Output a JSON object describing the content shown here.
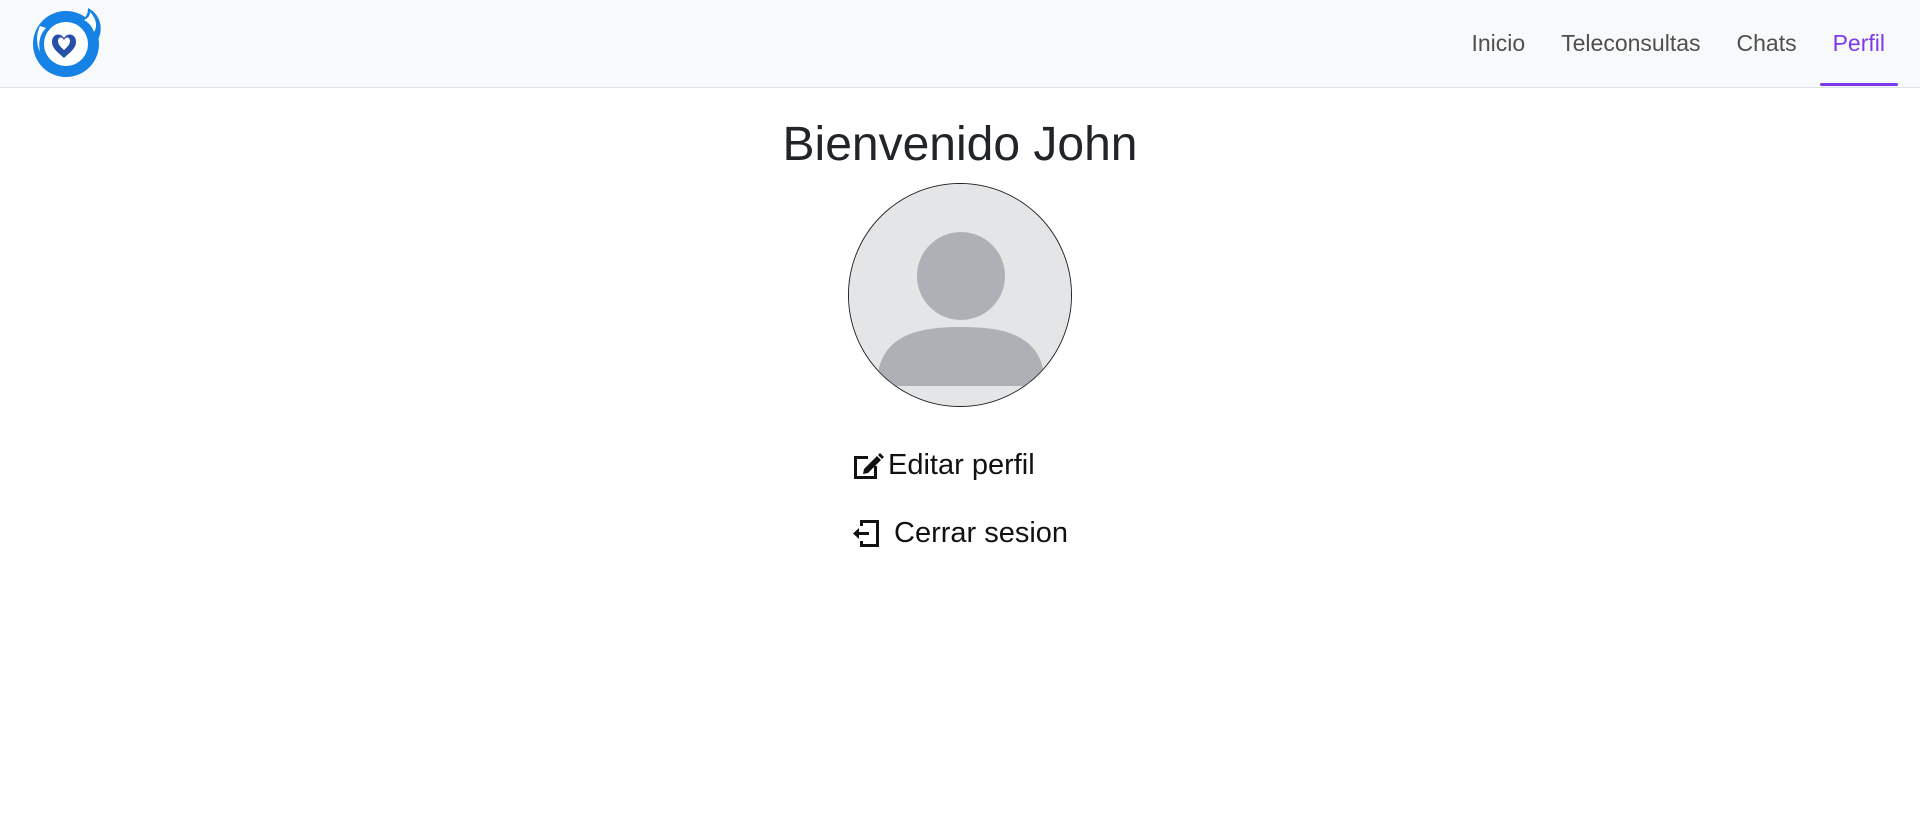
{
  "navbar": {
    "logo_name": "app-logo",
    "links": [
      {
        "label": "Inicio"
      },
      {
        "label": "Teleconsultas"
      },
      {
        "label": "Chats"
      },
      {
        "label": "Perfil",
        "active": true
      }
    ],
    "accent_color": "#7c3aed"
  },
  "profile": {
    "welcome": "Bienvenido John",
    "avatar_icon": "default-user-avatar",
    "actions": {
      "edit_label": "Editar perfil",
      "edit_icon": "edit-icon",
      "logout_label": "Cerrar sesion",
      "logout_icon": "logout-icon"
    }
  }
}
